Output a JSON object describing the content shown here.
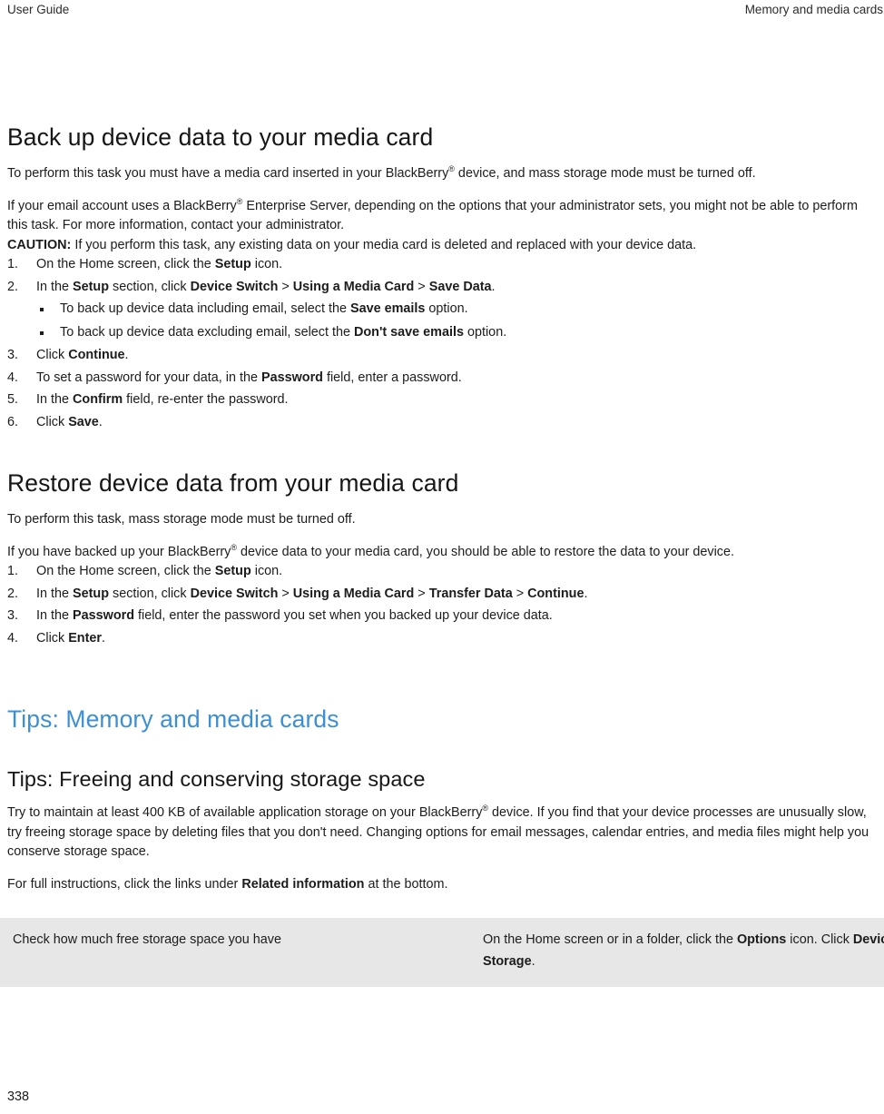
{
  "running_head": {
    "left": "User Guide",
    "right": "Memory and media cards"
  },
  "folio": "338",
  "colors": {
    "heading_blue": "#3d8fd4",
    "table_row_bg": "#e7e7e7",
    "text": "#1c1c1c"
  },
  "sections": [
    {
      "id": "backup",
      "title": "Back up device data to your media card",
      "title_color": "black",
      "intro_1": {
        "a": "To perform this task you must have a media card inserted in your BlackBerry",
        "reg": "®",
        "b": " device, and mass storage mode must be turned off."
      },
      "intro_2": {
        "a": "If your email account uses a BlackBerry",
        "reg": "®",
        "b": " Enterprise Server, depending on the options that your administrator sets, you might not be able to perform this task. For more information, contact your administrator."
      },
      "caution": {
        "label": "CAUTION:",
        "text": " If you perform this task, any existing data on your media card is deleted and replaced with your device data."
      },
      "steps": [
        {
          "num": "1.",
          "parts": [
            {
              "t": "On the Home screen, click the ",
              "b": false
            },
            {
              "t": "Setup",
              "b": true
            },
            {
              "t": " icon.",
              "b": false
            }
          ]
        },
        {
          "num": "2.",
          "parts": [
            {
              "t": "In the ",
              "b": false
            },
            {
              "t": "Setup",
              "b": true
            },
            {
              "t": " section, click ",
              "b": false
            },
            {
              "t": "Device Switch",
              "b": true
            },
            {
              "t": " > ",
              "b": false
            },
            {
              "t": "Using a Media Card",
              "b": true
            },
            {
              "t": " > ",
              "b": false
            },
            {
              "t": "Save Data",
              "b": true
            },
            {
              "t": ".",
              "b": false
            }
          ],
          "bullets": [
            [
              {
                "t": "To back up device data including email, select the ",
                "b": false
              },
              {
                "t": "Save emails",
                "b": true
              },
              {
                "t": " option.",
                "b": false
              }
            ],
            [
              {
                "t": "To back up device data excluding email, select the ",
                "b": false
              },
              {
                "t": "Don't save emails",
                "b": true
              },
              {
                "t": " option.",
                "b": false
              }
            ]
          ]
        },
        {
          "num": "3.",
          "parts": [
            {
              "t": "Click ",
              "b": false
            },
            {
              "t": "Continue",
              "b": true
            },
            {
              "t": ".",
              "b": false
            }
          ]
        },
        {
          "num": "4.",
          "parts": [
            {
              "t": "To set a password for your data, in the ",
              "b": false
            },
            {
              "t": "Password",
              "b": true
            },
            {
              "t": " field, enter a password.",
              "b": false
            }
          ]
        },
        {
          "num": "5.",
          "parts": [
            {
              "t": "In the ",
              "b": false
            },
            {
              "t": "Confirm",
              "b": true
            },
            {
              "t": " field, re-enter the password.",
              "b": false
            }
          ]
        },
        {
          "num": "6.",
          "parts": [
            {
              "t": "Click ",
              "b": false
            },
            {
              "t": "Save",
              "b": true
            },
            {
              "t": ".",
              "b": false
            }
          ]
        }
      ]
    },
    {
      "id": "restore",
      "title": "Restore device data from your media card",
      "title_color": "black",
      "intro_1": {
        "a": "To perform this task, mass storage mode must be turned off.",
        "reg": "",
        "b": ""
      },
      "intro_2": {
        "a": "If you have backed up your BlackBerry",
        "reg": "®",
        "b": " device data to your media card, you should be able to restore the data to your device."
      },
      "steps": [
        {
          "num": "1.",
          "parts": [
            {
              "t": "On the Home screen, click the ",
              "b": false
            },
            {
              "t": "Setup",
              "b": true
            },
            {
              "t": " icon.",
              "b": false
            }
          ]
        },
        {
          "num": "2.",
          "parts": [
            {
              "t": "In the ",
              "b": false
            },
            {
              "t": "Setup",
              "b": true
            },
            {
              "t": " section, click ",
              "b": false
            },
            {
              "t": "Device Switch",
              "b": true
            },
            {
              "t": " > ",
              "b": false
            },
            {
              "t": "Using a Media Card",
              "b": true
            },
            {
              "t": " > ",
              "b": false
            },
            {
              "t": "Transfer Data",
              "b": true
            },
            {
              "t": " > ",
              "b": false
            },
            {
              "t": "Continue",
              "b": true
            },
            {
              "t": ".",
              "b": false
            }
          ]
        },
        {
          "num": "3.",
          "parts": [
            {
              "t": "In the ",
              "b": false
            },
            {
              "t": "Password",
              "b": true
            },
            {
              "t": " field, enter the password you set when you backed up your device data.",
              "b": false
            }
          ]
        },
        {
          "num": "4.",
          "parts": [
            {
              "t": "Click ",
              "b": false
            },
            {
              "t": "Enter",
              "b": true
            },
            {
              "t": ".",
              "b": false
            }
          ]
        }
      ]
    }
  ],
  "tips": {
    "chapter_title": "Tips: Memory and media cards",
    "topic_title": "Tips: Freeing and conserving storage space",
    "paragraph_1": {
      "a": "Try to maintain at least 400 KB of available application storage on your BlackBerry",
      "reg": "®",
      "b": " device. If you find that your device processes are unusually slow, try freeing storage space by deleting files that you don't need. Changing options for email messages, calendar entries, and media files might help you conserve storage space."
    },
    "paragraph_2": [
      {
        "t": "For full instructions, click the links under ",
        "b": false
      },
      {
        "t": "Related information",
        "b": true
      },
      {
        "t": " at the bottom.",
        "b": false
      }
    ],
    "table": {
      "rows": [
        {
          "task": "Check how much free storage space you have",
          "action": [
            {
              "t": "On the Home screen or in a folder, click the ",
              "b": false
            },
            {
              "t": "Options",
              "b": true
            },
            {
              "t": " icon. Click ",
              "b": false
            },
            {
              "t": "Device",
              "b": true
            },
            {
              "t": " > ",
              "b": false
            },
            {
              "t": "Storage",
              "b": true
            },
            {
              "t": ".",
              "b": false
            }
          ]
        }
      ]
    }
  }
}
